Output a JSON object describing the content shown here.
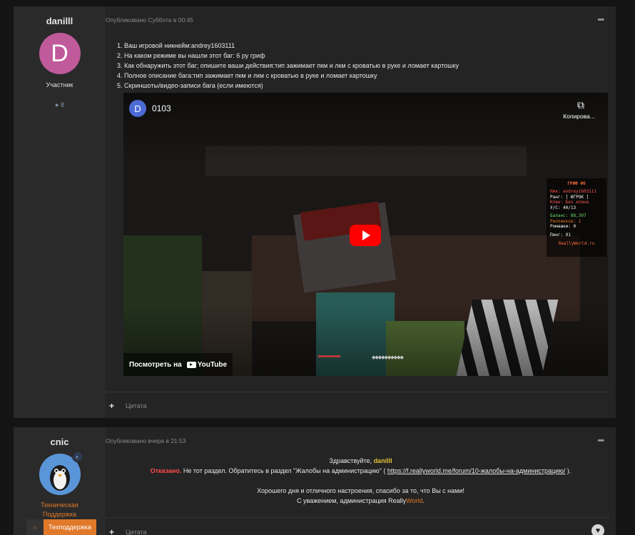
{
  "post1": {
    "author": {
      "name": "danilll",
      "avatar_letter": "D",
      "role": "Участник",
      "posts_count": "8"
    },
    "meta": "Опубликовано Суббота в 00:45",
    "answers": [
      "1. Ваш игровой никнейм:andrey1603111",
      "2. На каком режиме вы нашли этот баг: 6 ру гриф",
      "3. Как обнаружить этот баг; опишите ваши действия:тип зажимает пкм и лкм с кроватью в руке и ломает картошку",
      "4. Полное описание бага:тип зажимает пкм и лкм с кроватью в руке и ломает картошку",
      "5. Скриншоты/видео-записи бага (если имеются)"
    ],
    "video": {
      "channel_letter": "D",
      "title": "0103",
      "copy_label": "Копирова...",
      "watch_label": "Посмотреть на",
      "youtube_label": "YouTube",
      "scoreboard": {
        "title": "ГРИФ #6",
        "rows_a": [
          "Ник: andrey1603111",
          "Ранг: [ ИГРОК ]",
          "Клан: Без клана",
          "У/С: 40/13"
        ],
        "rows_b": [
          "Баланс: 88,397",
          "Риллинков: 1",
          "Ромашки: 0"
        ],
        "ping": "Пинг: 91",
        "site": "ReallyWorld.ru"
      }
    },
    "quote_label": "Цитата"
  },
  "post2": {
    "author": {
      "name": "cnic",
      "role_line1": "Техническая",
      "role_line2": "Поддержка",
      "badge": "Техподдержка"
    },
    "meta": "Опубликовано вчера в 21:53",
    "greeting": "Здравствуйте, ",
    "greeting_user": "danilll",
    "denied_word": "Отказано.",
    "denied_text": " Не тот раздел. Обратитесь в раздел \"Жалобы на администрацию\" ( ",
    "link": "https://f.reallyworld.me/forum/10-жалобы-на-администрацию/",
    "denied_tail": " ).",
    "wish": "Хорошего дня и отличного настроения, спасибо за то, что Вы с нами!",
    "sign_prefix": "С уважением, администрация Really",
    "sign_world": "World",
    "sign_suffix": ".",
    "quote_label": "Цитата"
  },
  "colors": {
    "accent": "#e0792a",
    "denied": "#ff4a4a",
    "username": "#e0c23a",
    "youtube_red": "#ff0000"
  }
}
